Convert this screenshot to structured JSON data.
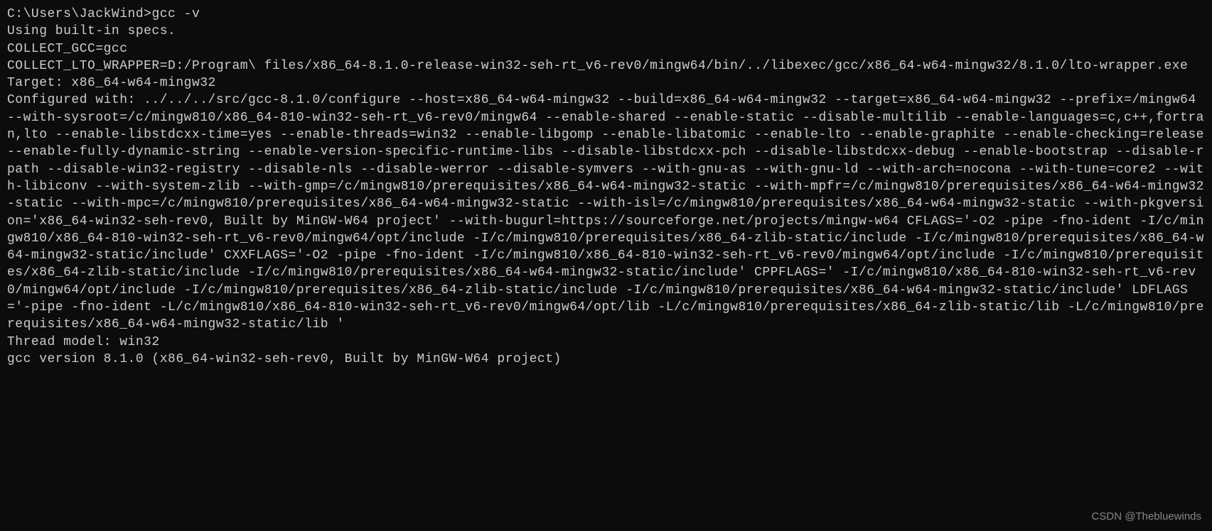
{
  "terminal": {
    "prompt": "C:\\Users\\JackWind>",
    "command": "gcc -v",
    "output_lines": [
      "Using built-in specs.",
      "COLLECT_GCC=gcc",
      "COLLECT_LTO_WRAPPER=D:/Program\\ files/x86_64-8.1.0-release-win32-seh-rt_v6-rev0/mingw64/bin/../libexec/gcc/x86_64-w64-mingw32/8.1.0/lto-wrapper.exe",
      "Target: x86_64-w64-mingw32",
      "Configured with: ../../../src/gcc-8.1.0/configure --host=x86_64-w64-mingw32 --build=x86_64-w64-mingw32 --target=x86_64-w64-mingw32 --prefix=/mingw64 --with-sysroot=/c/mingw810/x86_64-810-win32-seh-rt_v6-rev0/mingw64 --enable-shared --enable-static --disable-multilib --enable-languages=c,c++,fortran,lto --enable-libstdcxx-time=yes --enable-threads=win32 --enable-libgomp --enable-libatomic --enable-lto --enable-graphite --enable-checking=release --enable-fully-dynamic-string --enable-version-specific-runtime-libs --disable-libstdcxx-pch --disable-libstdcxx-debug --enable-bootstrap --disable-rpath --disable-win32-registry --disable-nls --disable-werror --disable-symvers --with-gnu-as --with-gnu-ld --with-arch=nocona --with-tune=core2 --with-libiconv --with-system-zlib --with-gmp=/c/mingw810/prerequisites/x86_64-w64-mingw32-static --with-mpfr=/c/mingw810/prerequisites/x86_64-w64-mingw32-static --with-mpc=/c/mingw810/prerequisites/x86_64-w64-mingw32-static --with-isl=/c/mingw810/prerequisites/x86_64-w64-mingw32-static --with-pkgversion='x86_64-win32-seh-rev0, Built by MinGW-W64 project' --with-bugurl=https://sourceforge.net/projects/mingw-w64 CFLAGS='-O2 -pipe -fno-ident -I/c/mingw810/x86_64-810-win32-seh-rt_v6-rev0/mingw64/opt/include -I/c/mingw810/prerequisites/x86_64-zlib-static/include -I/c/mingw810/prerequisites/x86_64-w64-mingw32-static/include' CXXFLAGS='-O2 -pipe -fno-ident -I/c/mingw810/x86_64-810-win32-seh-rt_v6-rev0/mingw64/opt/include -I/c/mingw810/prerequisites/x86_64-zlib-static/include -I/c/mingw810/prerequisites/x86_64-w64-mingw32-static/include' CPPFLAGS=' -I/c/mingw810/x86_64-810-win32-seh-rt_v6-rev0/mingw64/opt/include -I/c/mingw810/prerequisites/x86_64-zlib-static/include -I/c/mingw810/prerequisites/x86_64-w64-mingw32-static/include' LDFLAGS='-pipe -fno-ident -L/c/mingw810/x86_64-810-win32-seh-rt_v6-rev0/mingw64/opt/lib -L/c/mingw810/prerequisites/x86_64-zlib-static/lib -L/c/mingw810/prerequisites/x86_64-w64-mingw32-static/lib '",
      "Thread model: win32",
      "gcc version 8.1.0 (x86_64-win32-seh-rev0, Built by MinGW-W64 project)"
    ]
  },
  "watermark": "CSDN @Thebluewinds"
}
